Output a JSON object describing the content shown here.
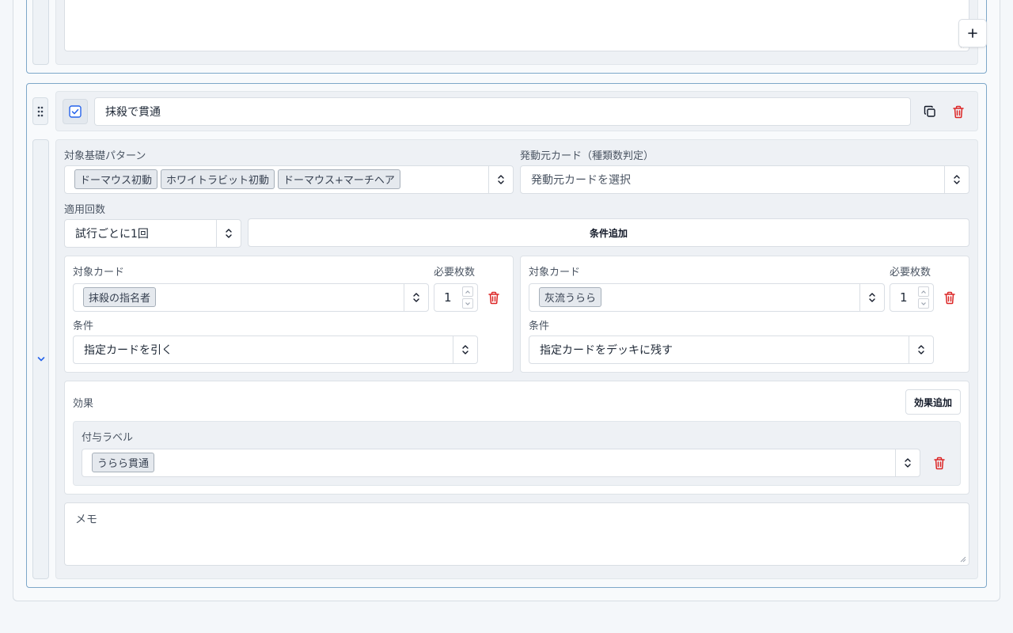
{
  "prev_rule": {
    "memo_text": "メモ",
    "add_icon": "plus-icon"
  },
  "rule": {
    "checked": true,
    "name": "抹殺で貫通",
    "copy_icon": "copy-icon",
    "delete_icon": "trash-icon",
    "collapse_icon": "chevron-down-icon",
    "base_pattern": {
      "label": "対象基礎パターン",
      "chips": [
        "ドーマウス初動",
        "ホワイトラビット初動",
        "ドーマウス+マーチヘア"
      ]
    },
    "source_card": {
      "label": "発動元カード（種類数判定）",
      "placeholder": "発動元カードを選択"
    },
    "apply_count": {
      "label": "適用回数",
      "value": "試行ごとに1回"
    },
    "add_condition_label": "条件追加",
    "conditions": [
      {
        "card_label": "対象カード",
        "card_chip": "抹殺の指名者",
        "count_label": "必要枚数",
        "count": "1",
        "cond_label": "条件",
        "cond_value": "指定カードを引く"
      },
      {
        "card_label": "対象カード",
        "card_chip": "灰流うらら",
        "count_label": "必要枚数",
        "count": "1",
        "cond_label": "条件",
        "cond_value": "指定カードをデッキに残す"
      }
    ],
    "effects": {
      "label": "効果",
      "add_label": "効果追加",
      "item": {
        "label": "付与ラベル",
        "chip": "うらら貫通"
      }
    },
    "memo_placeholder": "メモ"
  },
  "colors": {
    "accent": "#2563eb",
    "danger": "#dc2626",
    "border_accent": "#7da7c9"
  }
}
